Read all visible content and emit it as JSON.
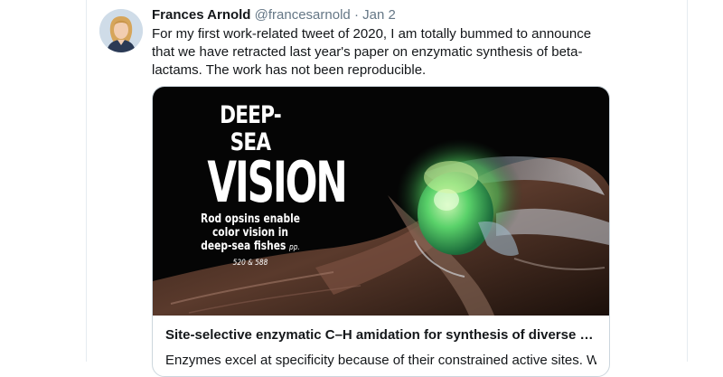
{
  "tweet": {
    "display_name": "Frances Arnold",
    "handle": "@francesarnold",
    "separator": "·",
    "date": "Jan 2",
    "text": "For my first work-related tweet of 2020, I am totally bummed to announce that we have retracted last year's paper on enzymatic synthesis of beta-lactams. The work has not been reproducible."
  },
  "card": {
    "cover": {
      "kicker": "DEEP-SEA",
      "title": "VISION",
      "subtitle": "Rod opsins enable color vision in deep-sea fishes",
      "pages": "pp. 520 & 588"
    },
    "title": "Site-selective enzymatic C–H amidation for synthesis of diverse lacta...",
    "description": "Enzymes excel at specificity because of their constrained active sites. With"
  },
  "colors": {
    "text_primary": "#14171a",
    "text_secondary": "#657786",
    "border": "#ccd6dd",
    "cover_background": "#050505",
    "eye_green": "#4cc85a"
  },
  "icons": {
    "avatar": "profile-photo"
  }
}
